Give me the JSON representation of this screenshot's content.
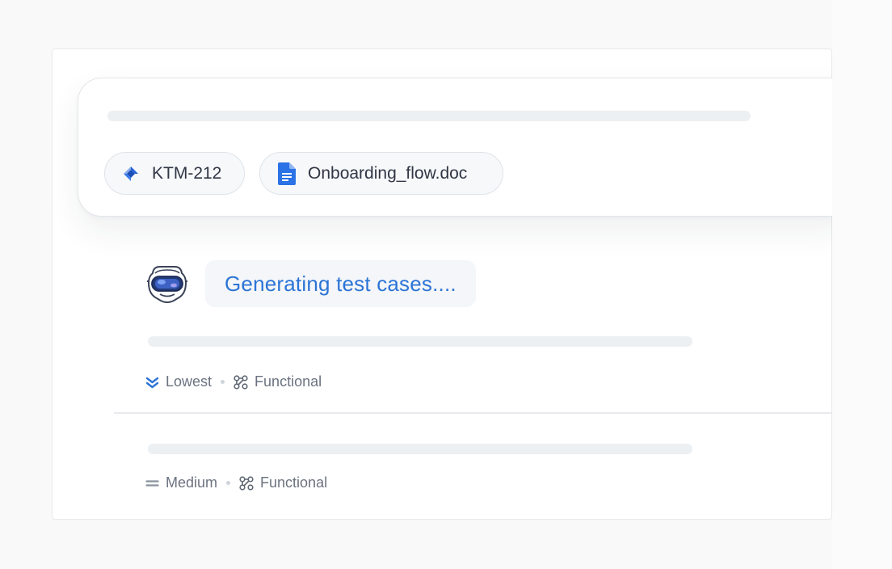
{
  "prompt": {
    "chips": [
      {
        "label": "KTM-212",
        "icon": "jira-icon",
        "icon_color": "#2563d6"
      },
      {
        "label": "Onboarding_flow.doc",
        "icon": "google-doc-icon",
        "icon_color": "#2b72e6"
      }
    ]
  },
  "status": {
    "text": "Generating test cases....",
    "avatar": "robot-vr-headset-icon",
    "text_color": "#2c74d6"
  },
  "test_cases": [
    {
      "priority": "Lowest",
      "priority_icon": "double-chevron-down-icon",
      "priority_color": "#2c74d6",
      "type": "Functional",
      "type_icon": "functional-nodes-icon"
    },
    {
      "priority": "Medium",
      "priority_icon": "equals-icon",
      "priority_color": "#8a929e",
      "type": "Functional",
      "type_icon": "functional-nodes-icon"
    }
  ]
}
